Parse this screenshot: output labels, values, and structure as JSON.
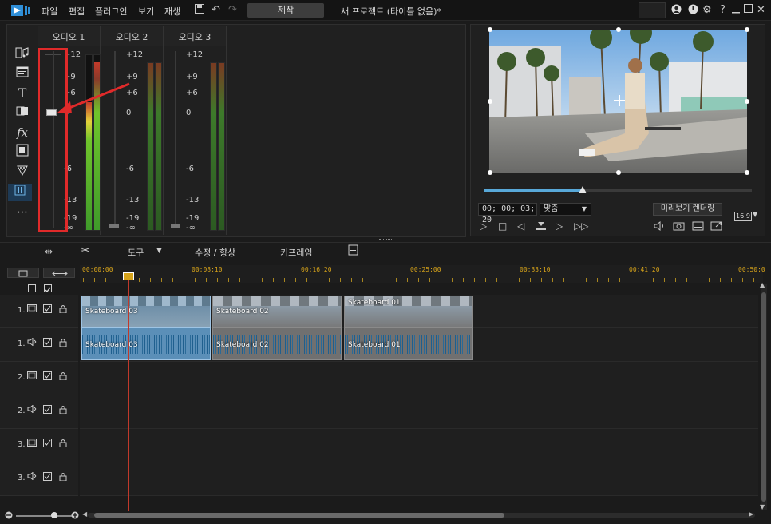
{
  "menu": {
    "file": "파일",
    "edit": "편집",
    "plugins": "플러그인",
    "view": "보기",
    "playback": "재생",
    "produce": "제작",
    "window_title": "새 프로젝트 (타이틀 없음)*"
  },
  "titlebar_icons": [
    "save-icon",
    "undo-icon",
    "redo-icon",
    "account-icon",
    "notification-icon",
    "settings-icon",
    "help-icon",
    "minimize-icon",
    "maximize-icon",
    "close-icon"
  ],
  "help_glyph": "?",
  "side_tools": [
    "media-room-icon",
    "title-room-icon",
    "text-icon",
    "transition-icon",
    "fx-icon",
    "pip-icon",
    "particle-icon",
    "audio-mixing-icon",
    "more-icon"
  ],
  "mixer": {
    "channels": [
      {
        "label": "오디오 1",
        "scale": [
          "+12",
          "+9",
          "+6",
          "0",
          "-6",
          "-13",
          "-19",
          "-∞"
        ]
      },
      {
        "label": "오디오 2",
        "scale": [
          "+12",
          "+9",
          "+6",
          "0",
          "-6",
          "-13",
          "-19",
          "-∞"
        ]
      },
      {
        "label": "오디오 3",
        "scale": [
          "+12",
          "+9",
          "+6",
          "0",
          "-6",
          "-13",
          "-19",
          "-∞"
        ]
      }
    ]
  },
  "preview": {
    "timecode": "00; 00; 03; 20",
    "fit_label": "맞춤",
    "render_preview": "미리보기 렌더링",
    "aspect": "16:9",
    "scrub_position": 0.37
  },
  "toolbar": {
    "tools_label": "도구",
    "fix_enhance": "수정 / 향상",
    "keyframe": "키프레임"
  },
  "ruler": {
    "labels": [
      "00;00;00",
      "00;08;10",
      "00;16;20",
      "00;25;00",
      "00;33;10",
      "00;41;20",
      "00;50;0"
    ]
  },
  "tracks": [
    {
      "num": "1.",
      "type": "video"
    },
    {
      "num": "1.",
      "type": "audio"
    },
    {
      "num": "2.",
      "type": "video"
    },
    {
      "num": "2.",
      "type": "audio"
    },
    {
      "num": "3.",
      "type": "video"
    },
    {
      "num": "3.",
      "type": "audio"
    }
  ],
  "clips": [
    {
      "video_label": "Skateboard 03",
      "audio_label": "Skateboard 03",
      "selected": true
    },
    {
      "video_label": "Skateboard 02",
      "audio_label": "Skateboard 02",
      "selected": false
    },
    {
      "video_label": "Skateboard 01",
      "audio_label": "Skateboard 01",
      "selected": false
    }
  ],
  "colors": {
    "accent": "#58a8d8",
    "ruler": "#d6a31a",
    "playhead": "#c0392b",
    "annotation": "#e02a2a"
  }
}
